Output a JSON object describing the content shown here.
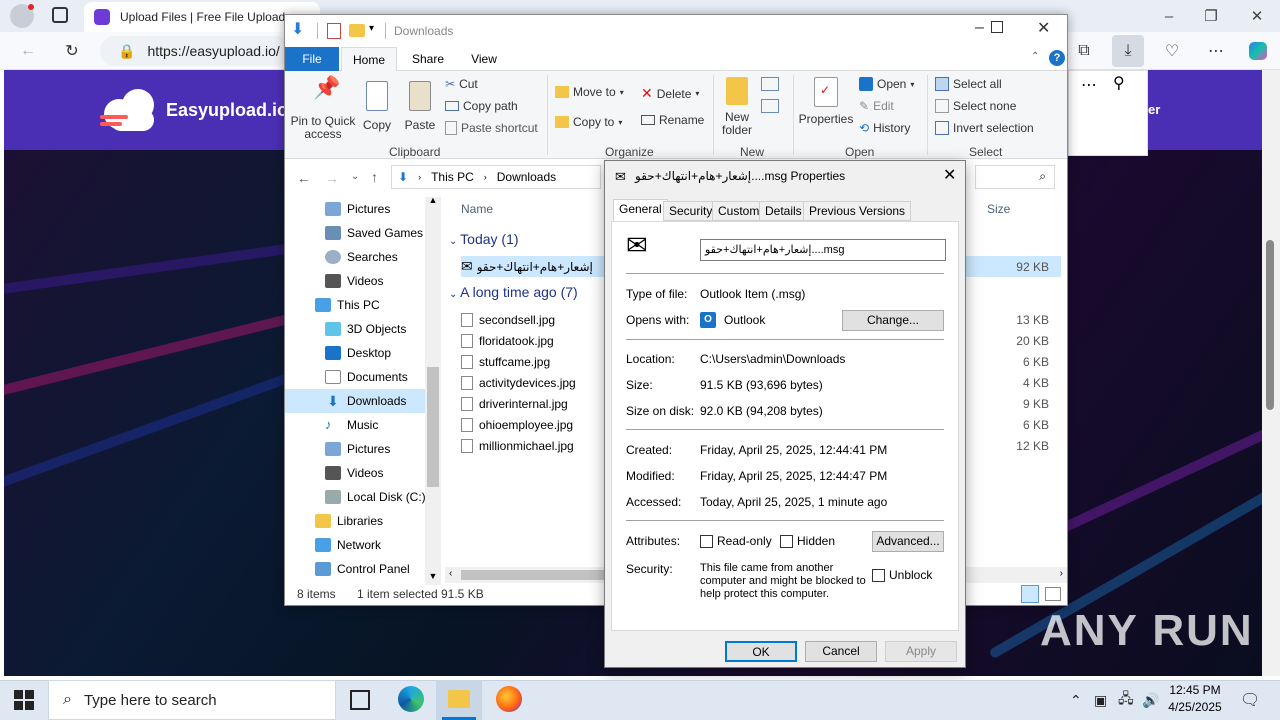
{
  "browser": {
    "tab_title": "Upload Files | Free File Upload a",
    "address": "https://easyupload.io/",
    "window_controls": [
      "–",
      "❐",
      "✕"
    ]
  },
  "site": {
    "logo_text": "Easyupload.io",
    "partial_text": "er"
  },
  "explorer": {
    "title": "Downloads",
    "tabs": [
      "File",
      "Home",
      "Share",
      "View"
    ],
    "ribbon": {
      "pin_label": "Pin to Quick access",
      "copy_label": "Copy",
      "paste_label": "Paste",
      "cut_label": "Cut",
      "copy_path_label": "Copy path",
      "paste_shortcut_label": "Paste shortcut",
      "clipboard_group": "Clipboard",
      "move_to_label": "Move to",
      "copy_to_label": "Copy to",
      "delete_label": "Delete",
      "rename_label": "Rename",
      "organize_group": "Organize",
      "new_folder_label": "New folder",
      "new_group": "New",
      "properties_label": "Properties",
      "open_label": "Open",
      "edit_label": "Edit",
      "history_label": "History",
      "open_group": "Open",
      "select_all_label": "Select all",
      "select_none_label": "Select none",
      "invert_selection_label": "Invert selection",
      "select_group": "Select"
    },
    "path": [
      "This PC",
      "Downloads"
    ],
    "nav_items": [
      "Pictures",
      "Saved Games",
      "Searches",
      "Videos",
      "This PC",
      "3D Objects",
      "Desktop",
      "Documents",
      "Downloads",
      "Music",
      "Pictures",
      "Videos",
      "Local Disk (C:)",
      "Libraries",
      "Network",
      "Control Panel"
    ],
    "column_name": "Name",
    "column_size": "Size",
    "group_today": "Today (1)",
    "group_old": "A long time ago (7)",
    "today_file": {
      "name": "إشعار+هام+انتهاك+حقو",
      "size": "92 KB"
    },
    "files": [
      {
        "name": "secondsell.jpg",
        "size": "13 KB"
      },
      {
        "name": "floridatook.jpg",
        "size": "20 KB"
      },
      {
        "name": "stuffcame.jpg",
        "size": "6 KB"
      },
      {
        "name": "activitydevices.jpg",
        "size": "4 KB"
      },
      {
        "name": "driverinternal.jpg",
        "size": "9 KB"
      },
      {
        "name": "ohioemployee.jpg",
        "size": "6 KB"
      },
      {
        "name": "millionmichael.jpg",
        "size": "12 KB"
      }
    ],
    "status_items": "8 items",
    "status_selected": "1 item selected",
    "status_size": "91.5 KB"
  },
  "props": {
    "title": "إشعار+هام+انتهاك+حقو....msg Properties",
    "tabs": [
      "General",
      "Security",
      "Custom",
      "Details",
      "Previous Versions"
    ],
    "filename": "إشعار+هام+انتهاك+حقو....msg",
    "type_label": "Type of file:",
    "type_value": "Outlook Item (.msg)",
    "opens_label": "Opens with:",
    "opens_value": "Outlook",
    "change_btn": "Change...",
    "location_label": "Location:",
    "location_value": "C:\\Users\\admin\\Downloads",
    "size_label": "Size:",
    "size_value": "91.5 KB (93,696 bytes)",
    "sod_label": "Size on disk:",
    "sod_value": "92.0 KB (94,208 bytes)",
    "created_label": "Created:",
    "created_value": "Friday, April 25, 2025, 12:44:41 PM",
    "modified_label": "Modified:",
    "modified_value": "Friday, April 25, 2025, 12:44:47 PM",
    "accessed_label": "Accessed:",
    "accessed_value": "Today, April 25, 2025, 1 minute ago",
    "attributes_label": "Attributes:",
    "readonly_label": "Read-only",
    "hidden_label": "Hidden",
    "advanced_btn": "Advanced...",
    "security_label": "Security:",
    "security_text": "This file came from another computer and might be blocked to help protect this computer.",
    "unblock_label": "Unblock",
    "ok_btn": "OK",
    "cancel_btn": "Cancel",
    "apply_btn": "Apply"
  },
  "taskbar": {
    "search_placeholder": "Type here to search",
    "time": "12:45 PM",
    "date": "4/25/2025"
  },
  "watermark": "ANY RUN"
}
